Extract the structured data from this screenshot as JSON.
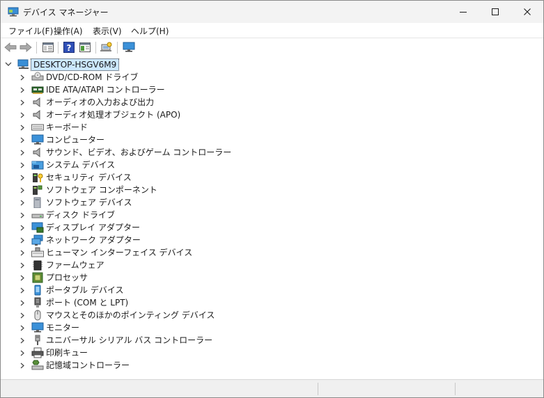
{
  "window": {
    "title": "デバイス マネージャー"
  },
  "menu": [
    {
      "label": "ファイル(F)"
    },
    {
      "label": "操作(A)"
    },
    {
      "label": "表示(V)"
    },
    {
      "label": "ヘルプ(H)"
    }
  ],
  "toolbar": [
    "back-arrow-icon",
    "forward-arrow-icon",
    "properties-sheet-icon",
    "help-icon",
    "view-panel-icon",
    "scan-hardware-icon",
    "monitor-icon"
  ],
  "tree": {
    "root": {
      "label": "DESKTOP-HSGV6M9",
      "icon": "computer-icon"
    },
    "items": [
      {
        "label": "DVD/CD-ROM ドライブ",
        "icon": "dvd-drive-icon"
      },
      {
        "label": "IDE ATA/ATAPI コントローラー",
        "icon": "ide-controller-icon"
      },
      {
        "label": "オーディオの入力および出力",
        "icon": "speaker-icon"
      },
      {
        "label": "オーディオ処理オブジェクト (APO)",
        "icon": "speaker-icon"
      },
      {
        "label": "キーボード",
        "icon": "keyboard-icon"
      },
      {
        "label": "コンピューター",
        "icon": "computer-icon"
      },
      {
        "label": "サウンド、ビデオ、およびゲーム コントローラー",
        "icon": "speaker-icon"
      },
      {
        "label": "システム デバイス",
        "icon": "system-folder-icon"
      },
      {
        "label": "セキュリティ デバイス",
        "icon": "security-key-icon"
      },
      {
        "label": "ソフトウェア コンポーネント",
        "icon": "software-component-icon"
      },
      {
        "label": "ソフトウェア デバイス",
        "icon": "software-device-icon"
      },
      {
        "label": "ディスク ドライブ",
        "icon": "disk-drive-icon"
      },
      {
        "label": "ディスプレイ アダプター",
        "icon": "display-adapter-icon"
      },
      {
        "label": "ネットワーク アダプター",
        "icon": "network-adapter-icon"
      },
      {
        "label": "ヒューマン インターフェイス デバイス",
        "icon": "hid-icon"
      },
      {
        "label": "ファームウェア",
        "icon": "firmware-chip-icon"
      },
      {
        "label": "プロセッサ",
        "icon": "processor-icon"
      },
      {
        "label": "ポータブル デバイス",
        "icon": "portable-device-icon"
      },
      {
        "label": "ポート (COM と LPT)",
        "icon": "port-icon"
      },
      {
        "label": "マウスとそのほかのポインティング デバイス",
        "icon": "mouse-icon"
      },
      {
        "label": "モニター",
        "icon": "monitor-icon"
      },
      {
        "label": "ユニバーサル シリアル バス コントローラー",
        "icon": "usb-icon"
      },
      {
        "label": "印刷キュー",
        "icon": "printer-icon"
      },
      {
        "label": "記憶域コントローラー",
        "icon": "storage-controller-icon"
      }
    ]
  }
}
